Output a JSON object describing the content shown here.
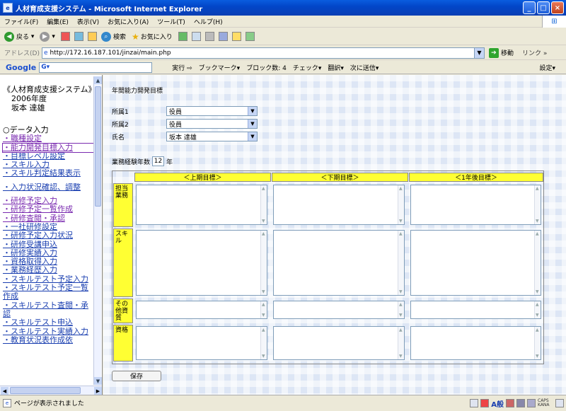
{
  "window": {
    "title": "人材育成支援システム - Microsoft Internet Explorer",
    "controls": [
      "_",
      "□",
      "×"
    ]
  },
  "menu": [
    "ファイル(F)",
    "編集(E)",
    "表示(V)",
    "お気に入り(A)",
    "ツール(T)",
    "ヘルプ(H)"
  ],
  "toolbar": {
    "back": "戻る",
    "search": "検索",
    "favorites": "お気に入り"
  },
  "address": {
    "label": "アドレス(D)",
    "url": "http://172.16.187.101/jinzai/main.php",
    "go": "移動",
    "links": "リンク »"
  },
  "google": {
    "logo": "Google",
    "search_value": "G▾",
    "buttons": [
      "実行 ⇨",
      "ブックマーク▾",
      "ブロック数: 4",
      "チェック▾",
      "翻訳▾",
      "次に送信▾"
    ],
    "settings": "設定▾"
  },
  "sidebar": {
    "header": [
      "《人材育成支援システム》",
      "2006年度",
      "坂本 達雄"
    ],
    "items": [
      {
        "label": "○データ入力",
        "kind": "hdr"
      },
      {
        "label": "・職種設定",
        "kind": "vis"
      },
      {
        "label": "・能力開発目標入力",
        "kind": "cur"
      },
      {
        "label": "・目標レベル設定",
        "kind": "lnk"
      },
      {
        "label": "・スキル入力",
        "kind": "lnk"
      },
      {
        "label": "・スキル判定結果表示",
        "kind": "lnk"
      },
      {
        "label": "",
        "kind": "hdr"
      },
      {
        "label": "・入力状況確認、調整",
        "kind": "lnk"
      },
      {
        "label": "",
        "kind": "hdr"
      },
      {
        "label": "・研修予定入力",
        "kind": "vis"
      },
      {
        "label": "・研修予定一覧作成",
        "kind": "vis"
      },
      {
        "label": "・研修査閲・承認",
        "kind": "vis"
      },
      {
        "label": "・一社研修設定",
        "kind": "lnk"
      },
      {
        "label": "・研修予定入力状況",
        "kind": "lnk"
      },
      {
        "label": "・研修受講申込",
        "kind": "lnk"
      },
      {
        "label": "・研修実績入力",
        "kind": "lnk"
      },
      {
        "label": "・資格取得入力",
        "kind": "lnk"
      },
      {
        "label": "・業務経歴入力",
        "kind": "lnk"
      },
      {
        "label": "・スキルテスト予定入力",
        "kind": "lnk"
      },
      {
        "label": "・スキルテスト予定一覧",
        "kind": "lnk"
      },
      {
        "label": "作成",
        "kind": "lnk"
      },
      {
        "label": "・スキルテスト査閲・承",
        "kind": "lnk"
      },
      {
        "label": "認",
        "kind": "lnk"
      },
      {
        "label": "・スキルテスト申込",
        "kind": "lnk"
      },
      {
        "label": "・スキルテスト実績入力",
        "kind": "lnk"
      },
      {
        "label": "・教育状況表作成依",
        "kind": "lnk"
      }
    ]
  },
  "form": {
    "title": "年間能力開発目標",
    "fields": [
      {
        "label": "所属1",
        "value": "役員"
      },
      {
        "label": "所属2",
        "value": "役員"
      },
      {
        "label": "氏名",
        "value": "坂本 達雄"
      }
    ],
    "years_label": "業務経験年数",
    "years_value": "12",
    "years_unit": "年",
    "columns": [
      "＜上期目標＞",
      "＜下期目標＞",
      "＜1年後目標＞"
    ],
    "rows": [
      "担当業務",
      "スキル",
      "その他資質",
      "資格"
    ],
    "save": "保存"
  },
  "status": {
    "text": "ページが表示されました",
    "ime": "A般",
    "caps": "CAPS KANA"
  }
}
